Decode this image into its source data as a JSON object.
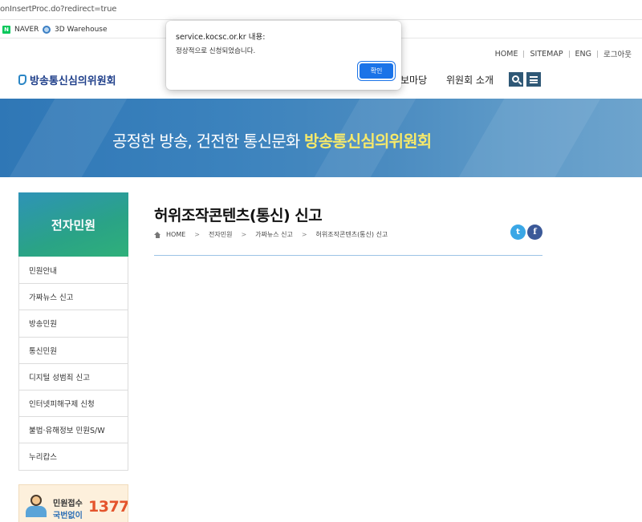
{
  "browser": {
    "url": "onInsertProc.do?redirect=true",
    "bookmarks": [
      {
        "label": "NAVER",
        "icon": "naver-icon"
      },
      {
        "label": "3D Warehouse",
        "icon": "3d-warehouse-icon"
      }
    ]
  },
  "header": {
    "logo": "방송통신심의위원회",
    "top_links": [
      "HOME",
      "SITEMAP",
      "ENG",
      "로그아웃"
    ],
    "nav": [
      {
        "label": "보마당"
      },
      {
        "label": "위원회 소개"
      }
    ],
    "search_icon": "search-icon",
    "menu_icon": "menu-icon"
  },
  "banner": {
    "slogan_plain": "공정한 방송, 건전한 통신문화",
    "slogan_highlight": "방송통신심의위원회"
  },
  "sidebar": {
    "title": "전자민원",
    "items": [
      {
        "label": "민원안내"
      },
      {
        "label": "가짜뉴스 신고"
      },
      {
        "label": "방송민원"
      },
      {
        "label": "통신민원"
      },
      {
        "label": "디지털 성범죄 신고"
      },
      {
        "label": "인터넷피해구제 신청"
      },
      {
        "label": "불법·유해정보 민원S/W"
      },
      {
        "label": "누리캅스"
      }
    ],
    "promo": {
      "line1": "민원접수",
      "line2": "국번없이",
      "number": "1377"
    }
  },
  "main": {
    "title": "허위조작콘텐츠(통신) 신고",
    "breadcrumb": [
      "HOME",
      "전자민원",
      "가짜뉴스 신고",
      "허위조작콘텐츠(통신) 신고"
    ],
    "share": {
      "twitter": "twitter-icon",
      "facebook": "facebook-icon"
    }
  },
  "dialog": {
    "title": "service.kocsc.or.kr 내용:",
    "message": "정상적으로 신청되었습니다.",
    "ok_label": "확인"
  },
  "colors": {
    "accent": "#1a73e8",
    "banner": "#3b82bd",
    "highlight": "#f6e96a",
    "sidebar_title": "#2aa386",
    "logo": "#1f3f8a",
    "promo_number": "#e4542c"
  }
}
